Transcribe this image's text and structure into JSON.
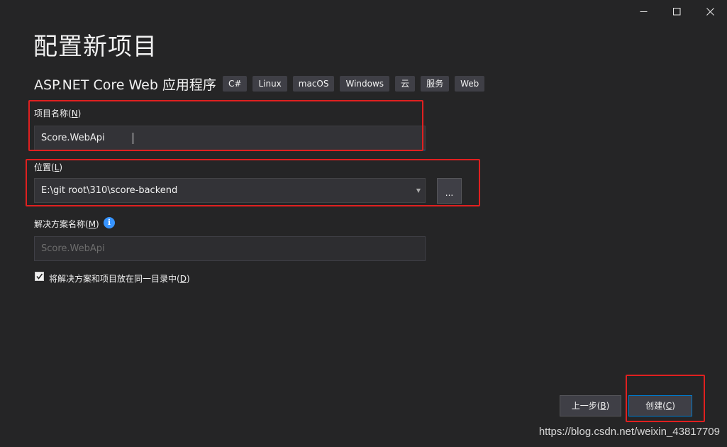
{
  "window": {
    "controls": [
      "minimize-icon",
      "maximize-icon",
      "close-icon"
    ]
  },
  "page": {
    "title": "配置新项目",
    "template_name": "ASP.NET Core Web 应用程序",
    "tags": [
      "C#",
      "Linux",
      "macOS",
      "Windows",
      "云",
      "服务",
      "Web"
    ]
  },
  "project_name": {
    "label": "项目名称(",
    "accesskey": "N",
    "label_end": ")",
    "value": "Score.WebApi"
  },
  "location": {
    "label": "位置(",
    "accesskey": "L",
    "label_end": ")",
    "value": "E:\\git root\\310\\score-backend",
    "browse_label": "..."
  },
  "solution_name": {
    "label": "解决方案名称(",
    "accesskey": "M",
    "label_end": ")",
    "placeholder": "Score.WebApi",
    "info_icon": "info-icon"
  },
  "same_directory": {
    "checked": true,
    "label": "将解决方案和项目放在同一目录中(",
    "accesskey": "D",
    "label_end": ")"
  },
  "footer": {
    "back_label": "上一步(",
    "back_key": "B",
    "create_label": "创建(",
    "create_key": "C",
    "paren_end": ")"
  },
  "watermark": "https://blog.csdn.net/weixin_43817709",
  "colors": {
    "background": "#252526",
    "accent": "#007acc",
    "annotation_red": "#e02020"
  }
}
